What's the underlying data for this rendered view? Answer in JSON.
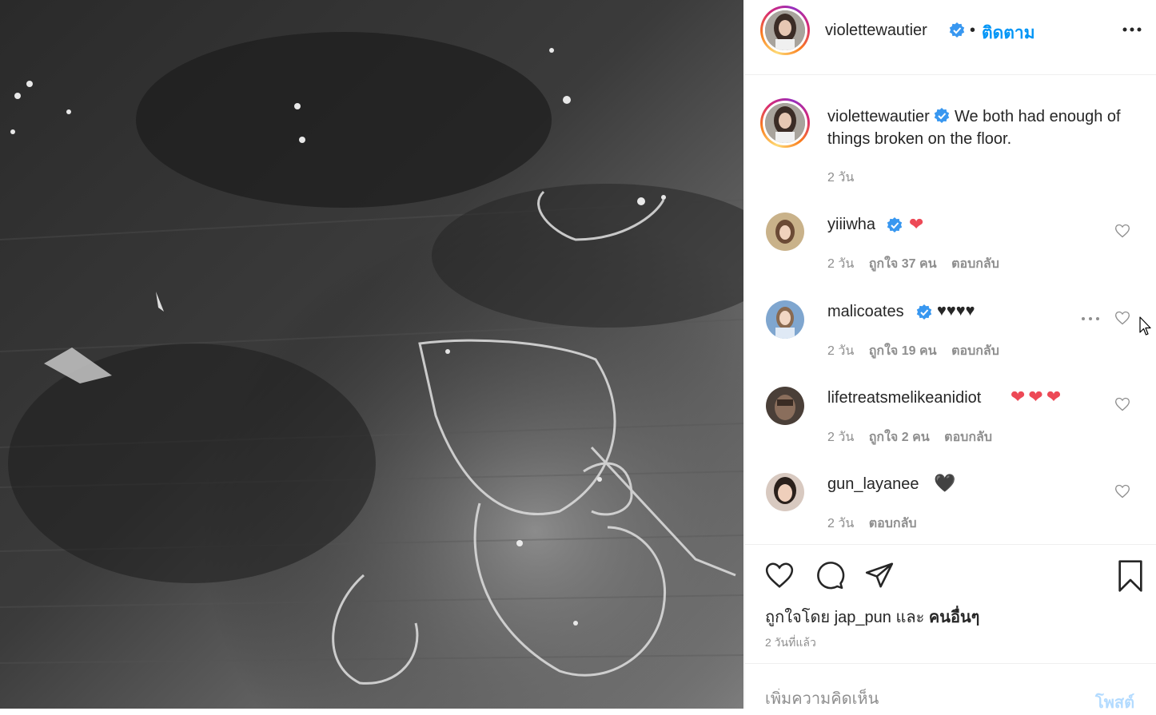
{
  "post": {
    "username": "violettewautier",
    "separator": "•",
    "follow_label": "ติดตาม",
    "caption": "We both had enough of things broken on the floor.",
    "caption_time": "2 วัน",
    "photo_alt": "broken-wine-glass-photo"
  },
  "comments": [
    {
      "username": "yiiiwha",
      "verified": true,
      "hearts": "❤",
      "time": "2 วัน",
      "likes": "ถูกใจ 37 คน",
      "reply": "ตอบกลับ"
    },
    {
      "username": "malicoates",
      "verified": true,
      "hearts": "♥♥♥♥",
      "time": "2 วัน",
      "likes": "ถูกใจ 19 คน",
      "reply": "ตอบกลับ"
    },
    {
      "username": "lifetreatsmelikeanidiot",
      "verified": false,
      "hearts": "❤❤❤",
      "time": "2 วัน",
      "likes": "ถูกใจ 2 คน",
      "reply": "ตอบกลับ"
    },
    {
      "username": "gun_layanee",
      "verified": false,
      "hearts": "🖤",
      "time": "2 วัน",
      "likes": "",
      "reply": "ตอบกลับ"
    }
  ],
  "likes": {
    "prefix": "ถูกใจโดย",
    "user": "jap_pun",
    "and": "และ",
    "others": "คนอื่นๆ"
  },
  "posted_ago": "2 วันที่แล้ว",
  "comment_input": {
    "placeholder": "เพิ่มความคิดเห็น",
    "post_label": "โพสต์"
  },
  "colors": {
    "accent": "#0095f6",
    "verified": "#3897f0",
    "heart_red": "#ed4956",
    "muted": "#8e8e8e"
  },
  "icons": [
    "verified-badge-icon",
    "more-options-icon",
    "heart-icon",
    "comment-icon",
    "share-icon",
    "bookmark-icon"
  ]
}
